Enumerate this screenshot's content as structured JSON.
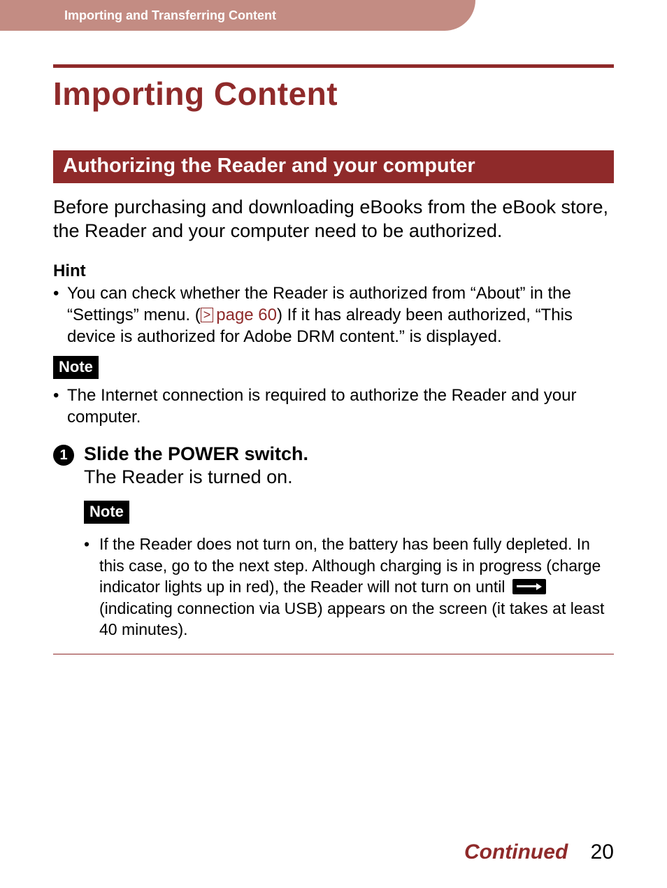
{
  "header": {
    "breadcrumb": "Importing and Transferring Content"
  },
  "title": "Importing Content",
  "section": {
    "heading": "Authorizing the Reader and your computer",
    "intro": "Before purchasing and downloading eBooks from the eBook store, the Reader and your computer need to be authorized."
  },
  "hint": {
    "label": "Hint",
    "bullet_pre": "You can check whether the Reader is authorized from “About” in the “Settings” menu. (",
    "link_glyph": ">",
    "link_text": "page 60",
    "bullet_post": ") If it has already been authorized, “This device is authorized for Adobe DRM content.” is displayed."
  },
  "note1": {
    "label": "Note",
    "bullet": "The Internet connection is required to authorize the Reader and your computer."
  },
  "step1": {
    "num": "1",
    "title": "Slide the POWER switch.",
    "desc": "The Reader is turned on.",
    "note_label": "Note",
    "bullet_pre": "If the Reader does not turn on, the battery has been fully depleted. In this case, go to the next step. Although charging is in progress (charge indicator lights up in red), the Reader will not turn on until ",
    "bullet_post": " (indicating connection via USB) appears on the screen (it takes at least 40 minutes)."
  },
  "footer": {
    "continued": "Continued",
    "page": "20"
  }
}
